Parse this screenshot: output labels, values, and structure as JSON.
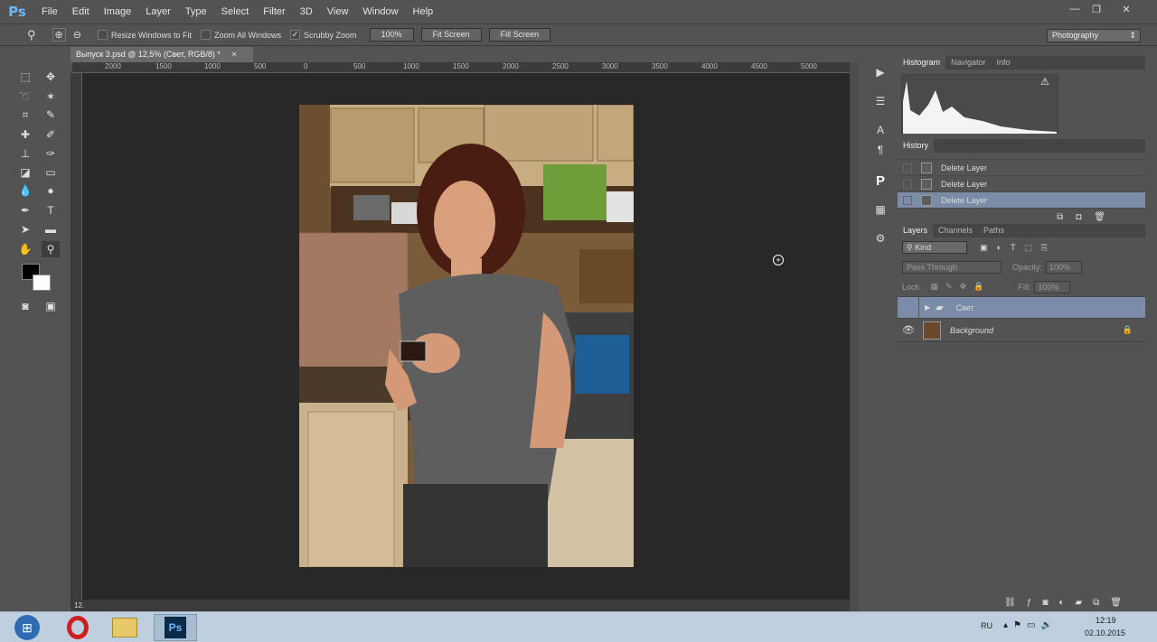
{
  "app": {
    "logo": "Ps",
    "window_controls": {
      "minimize": "—",
      "restore": "❐",
      "close": "✕"
    }
  },
  "menu": [
    "File",
    "Edit",
    "Image",
    "Layer",
    "Type",
    "Select",
    "Filter",
    "3D",
    "View",
    "Window",
    "Help"
  ],
  "options_bar": {
    "resize_windows": "Resize Windows to Fit",
    "zoom_all": "Zoom All Windows",
    "scrubby_zoom": "Scrubby Zoom",
    "scrubby_checked": true,
    "zoom_value": "100%",
    "fit_screen": "Fit Screen",
    "fill_screen": "Fill Screen",
    "workspace": "Photography"
  },
  "document": {
    "tab_title": "Выпуск 3.psd @ 12,5% (Свет, RGB/8) *",
    "close": "×",
    "zoom_status": "12.",
    "ruler_h": [
      "2000",
      "1500",
      "1000",
      "500",
      "0",
      "500",
      "1000",
      "1500",
      "2000",
      "2500",
      "3000",
      "3500",
      "4000",
      "4500",
      "5000"
    ]
  },
  "panels": {
    "histogram_tabs": [
      "Histogram",
      "Navigator",
      "Info"
    ],
    "history": {
      "title": "History",
      "items": [
        "Delete Layer",
        "Delete Layer",
        "Delete Layer"
      ],
      "selected_index": 2
    },
    "layers": {
      "tabs": [
        "Layers",
        "Channels",
        "Paths"
      ],
      "kind": "Kind",
      "blend_mode": "Pass Through",
      "opacity_label": "Opacity:",
      "opacity_value": "100%",
      "lock_label": "Lock:",
      "fill_label": "Fill:",
      "fill_value": "100%",
      "items": [
        {
          "name": "Свет",
          "type": "group",
          "selected": true
        },
        {
          "name": "Background",
          "type": "image",
          "locked": true
        }
      ]
    }
  },
  "taskbar": {
    "lang": "RU",
    "time": "12:19",
    "date": "02.10.2015"
  },
  "colors": {
    "bg": "#535353",
    "canvas": "#282828",
    "selection": "#7a8ca8",
    "accent": "#6fb6f5"
  }
}
